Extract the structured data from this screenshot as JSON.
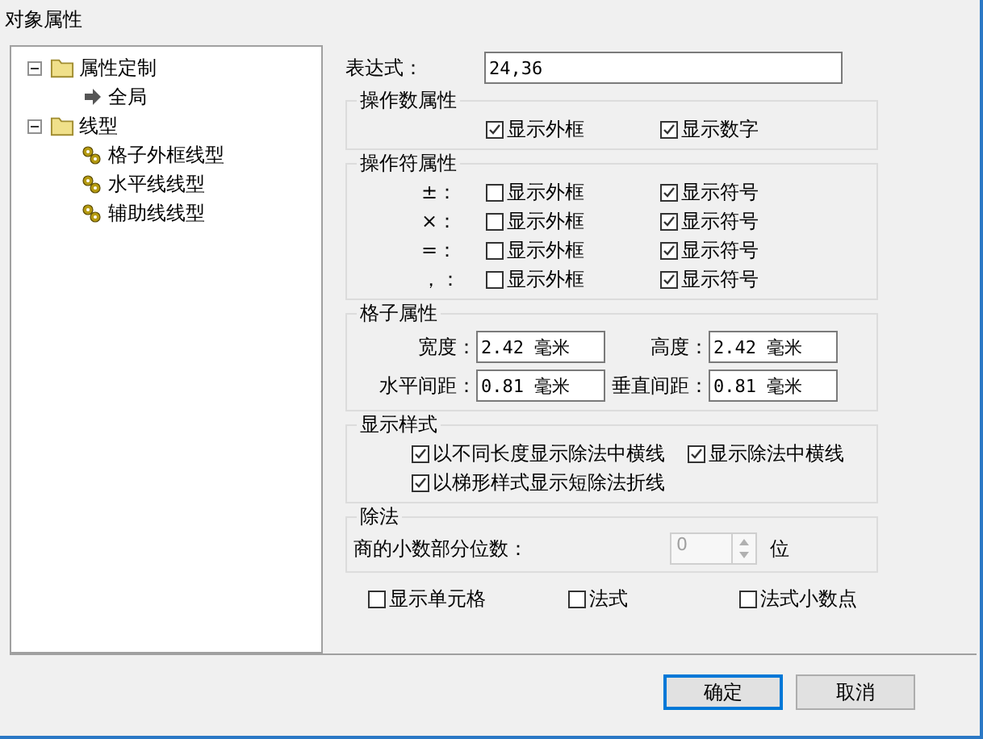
{
  "window": {
    "title": "对象属性"
  },
  "tree": [
    {
      "label": "属性定制",
      "kind": "folder",
      "expanded": true,
      "children": [
        {
          "label": "全局",
          "kind": "arrow"
        }
      ]
    },
    {
      "label": "线型",
      "kind": "folder",
      "expanded": true,
      "children": [
        {
          "label": "格子外框线型",
          "kind": "style"
        },
        {
          "label": "水平线线型",
          "kind": "style"
        },
        {
          "label": "辅助线线型",
          "kind": "style"
        }
      ]
    }
  ],
  "expression": {
    "label": "表达式：",
    "value": "24,36"
  },
  "operand_group": {
    "title": "操作数属性",
    "checkboxes": [
      {
        "label": "显示外框",
        "checked": true
      },
      {
        "label": "显示数字",
        "checked": true
      }
    ]
  },
  "operator_group": {
    "title": "操作符属性",
    "rows": [
      {
        "symbol": "±：",
        "frame": {
          "label": "显示外框",
          "checked": false
        },
        "sign": {
          "label": "显示符号",
          "checked": true
        }
      },
      {
        "symbol": "×：",
        "frame": {
          "label": "显示外框",
          "checked": false
        },
        "sign": {
          "label": "显示符号",
          "checked": true
        }
      },
      {
        "symbol": "=：",
        "frame": {
          "label": "显示外框",
          "checked": false
        },
        "sign": {
          "label": "显示符号",
          "checked": true
        }
      },
      {
        "symbol": "，：",
        "frame": {
          "label": "显示外框",
          "checked": false
        },
        "sign": {
          "label": "显示符号",
          "checked": true
        }
      }
    ]
  },
  "grid_group": {
    "title": "格子属性",
    "fields": [
      {
        "label": "宽度：",
        "value": "2.42 毫米"
      },
      {
        "label": "高度：",
        "value": "2.42 毫米"
      },
      {
        "label": "水平间距：",
        "value": "0.81 毫米"
      },
      {
        "label": "垂直间距：",
        "value": "0.81 毫米"
      }
    ]
  },
  "style_group": {
    "title": "显示样式",
    "checkboxes": [
      {
        "label": "以不同长度显示除法中横线",
        "checked": true
      },
      {
        "label": "显示除法中横线",
        "checked": true
      },
      {
        "label": "以梯形样式显示短除法折线",
        "checked": true
      }
    ]
  },
  "division_group": {
    "title": "除法",
    "label": "商的小数部分位数：",
    "spinner": {
      "value": "0",
      "disabled": true
    },
    "unit": "位"
  },
  "bottom_checkboxes": [
    {
      "label": "显示单元格",
      "checked": false
    },
    {
      "label": "法式",
      "checked": false
    },
    {
      "label": "法式小数点",
      "checked": false
    }
  ],
  "buttons": [
    {
      "label": "确定",
      "default": true
    },
    {
      "label": "取消",
      "default": false
    }
  ]
}
